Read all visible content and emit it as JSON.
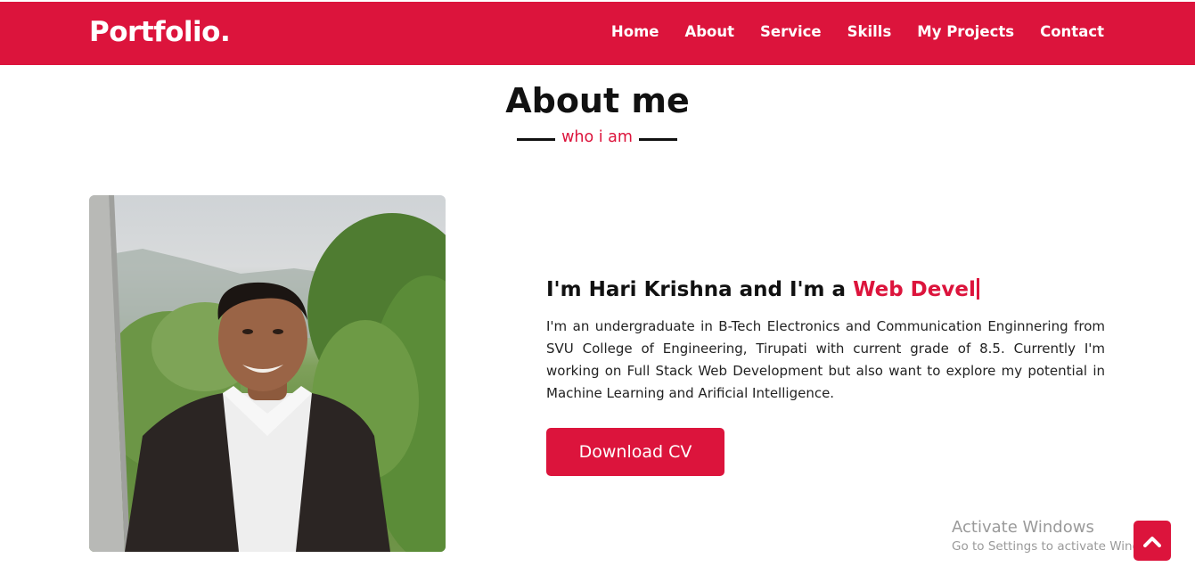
{
  "brand": {
    "logo": "Portfolio."
  },
  "nav": {
    "items": [
      "Home",
      "About",
      "Service",
      "Skills",
      "My Projects",
      "Contact"
    ]
  },
  "about": {
    "title": "About me",
    "subtitle": "who i am",
    "headline_prefix": "I'm Hari Krishna and I'm a ",
    "headline_typed": "Web Devel",
    "paragraph": "I'm an undergraduate in B-Tech Electronics and Communication Enginnering from SVU College of Engineering, Tirupati with current grade of 8.5. Currently I'm working on Full Stack Web Development but also want to explore my potential in Machine Learning and Arificial Intelligence.",
    "cv_button": "Download CV"
  },
  "watermark": {
    "line1": "Activate Windows",
    "line2": "Go to Settings to activate Windows."
  },
  "icons": {
    "scroll_top": "chevron-up-icon",
    "photo": "profile-photo"
  },
  "colors": {
    "accent": "#dc143c",
    "text": "#111111",
    "background": "#ffffff"
  }
}
